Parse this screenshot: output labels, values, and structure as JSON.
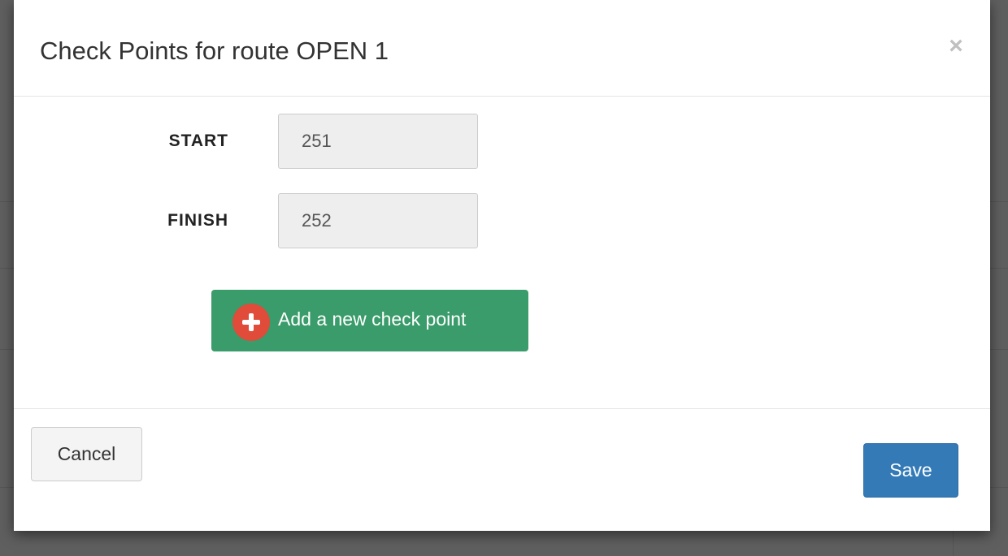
{
  "modal": {
    "title": "Check Points for route OPEN 1",
    "close_label": "×"
  },
  "form": {
    "start": {
      "label": "START",
      "value": "251"
    },
    "finish": {
      "label": "FINISH",
      "value": "252"
    }
  },
  "actions": {
    "add_checkpoint_label": "Add a new check point",
    "cancel_label": "Cancel",
    "save_label": "Save"
  },
  "colors": {
    "add_button": "#3a9b6b",
    "add_icon": "#e04b3a",
    "save_button": "#337ab7",
    "backdrop": "#5f5f5f"
  },
  "icons": {
    "add": "plus-circle-icon",
    "close": "close-icon"
  }
}
